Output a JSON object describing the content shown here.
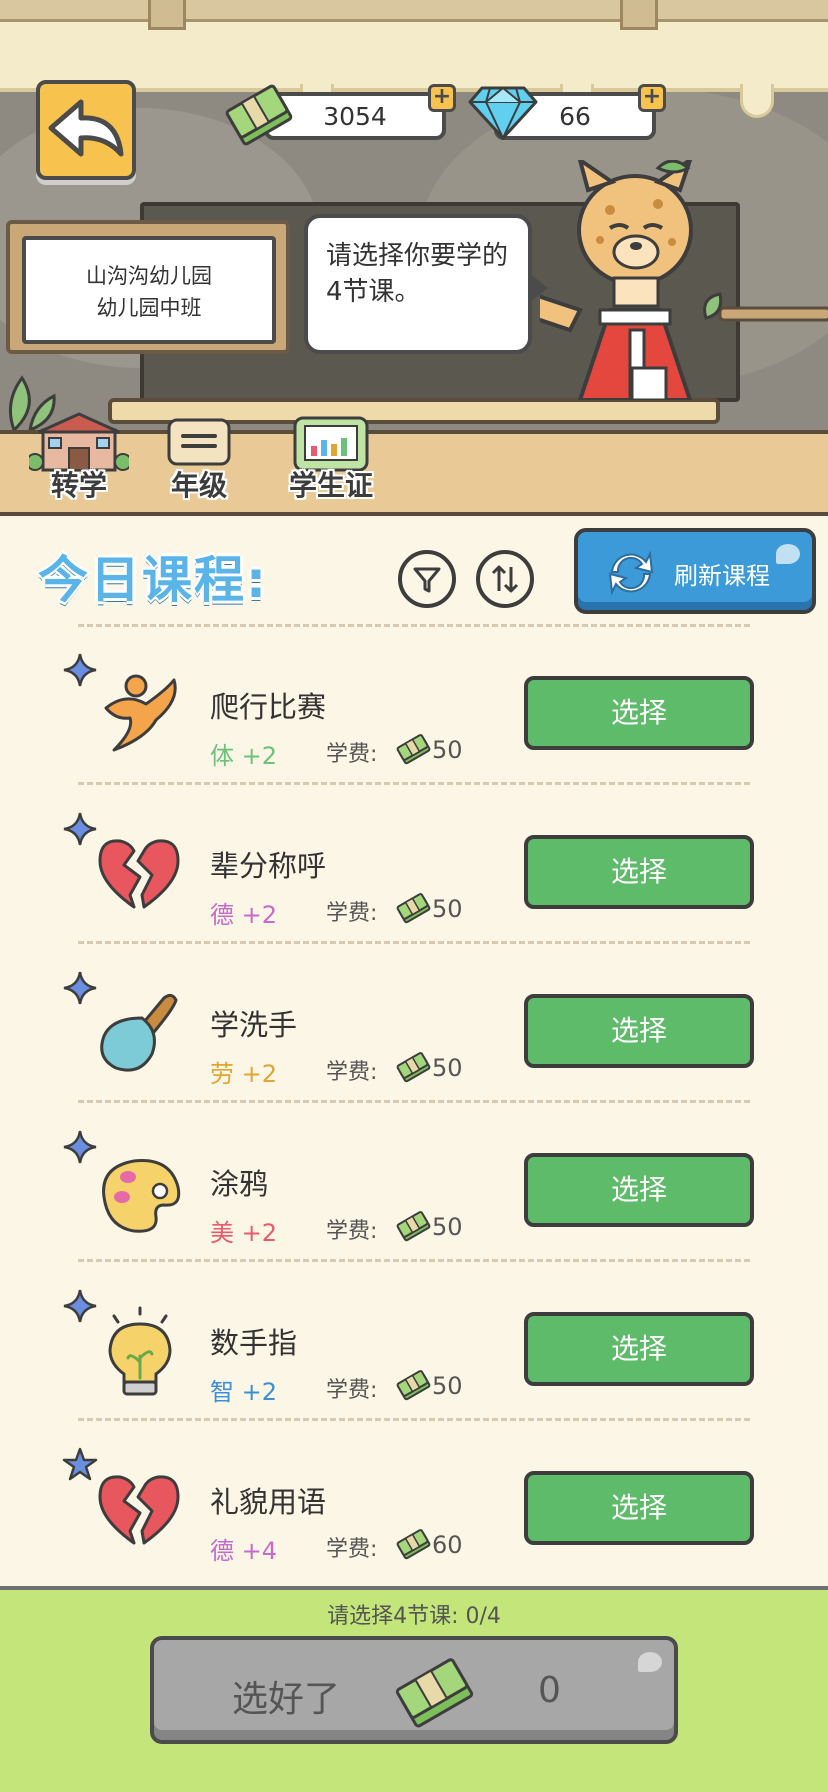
{
  "currency": {
    "money": "3054",
    "gems": "66",
    "icons": {
      "money": "cash-stack-icon",
      "gems": "diamond-icon",
      "add": "plus-icon"
    }
  },
  "school": {
    "name": "山沟沟幼儿园",
    "class": "幼儿园中班"
  },
  "teacher": {
    "speech": "请选择你要学的4节课。"
  },
  "nav": [
    {
      "label": "转学",
      "icon": "school-building-icon"
    },
    {
      "label": "年级",
      "icon": "grade-book-icon"
    },
    {
      "label": "学生证",
      "icon": "student-card-icon"
    }
  ],
  "courses_panel": {
    "title": "今日课程:",
    "filter_icon": "filter-icon",
    "sort_icon": "sort-icon",
    "refresh_label": "刷新课程",
    "fee_label": "学费:",
    "select_label": "选择"
  },
  "courses": [
    {
      "name": "爬行比赛",
      "stat": "体 +2",
      "fee": "50",
      "icon": "running-person-icon",
      "stat_color": "#6cc27b"
    },
    {
      "name": "辈分称呼",
      "stat": "德 +2",
      "fee": "50",
      "icon": "broken-heart-icon",
      "stat_color": "#c86ac9"
    },
    {
      "name": "学洗手",
      "stat": "劳 +2",
      "fee": "50",
      "icon": "shovel-icon",
      "stat_color": "#e0a533"
    },
    {
      "name": "涂鸦",
      "stat": "美 +2",
      "fee": "50",
      "icon": "paint-palette-icon",
      "stat_color": "#e95a6a"
    },
    {
      "name": "数手指",
      "stat": "智 +2",
      "fee": "50",
      "icon": "light-bulb-icon",
      "stat_color": "#3a8fd6"
    },
    {
      "name": "礼貌用语",
      "stat": "德 +4",
      "fee": "60",
      "icon": "broken-heart-icon",
      "stat_color": "#c86ac9"
    }
  ],
  "footer": {
    "prompt": "请选择4节课: 0/4",
    "confirm_label": "选好了",
    "total_cost": "0"
  },
  "colors": {
    "accent_blue": "#5ab4e8",
    "select_green": "#5ebb69",
    "bottom_green": "#c3e57a",
    "back_yellow": "#f8c24e"
  }
}
